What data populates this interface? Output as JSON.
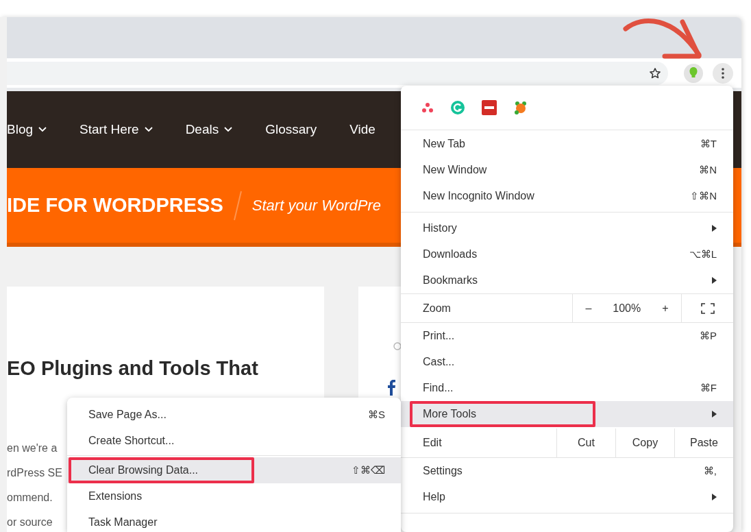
{
  "site": {
    "nav": [
      {
        "label": "Blog",
        "dropdown": true
      },
      {
        "label": "Start Here",
        "dropdown": true
      },
      {
        "label": "Deals",
        "dropdown": true
      },
      {
        "label": "Glossary",
        "dropdown": false
      },
      {
        "label": "Vide",
        "dropdown": false
      }
    ],
    "banner": {
      "title": "IDE FOR WORDPRESS",
      "tagline": "Start your WordPre"
    },
    "article": {
      "heading": "EO Plugins and Tools That",
      "lines": [
        "en we're a",
        "rdPress SE",
        "ommend.",
        "or source"
      ]
    }
  },
  "menu": {
    "items": [
      {
        "kind": "item",
        "label": "New Tab",
        "shortcut": "⌘T",
        "submenu": false,
        "selected": false,
        "annotated": false
      },
      {
        "kind": "item",
        "label": "New Window",
        "shortcut": "⌘N",
        "submenu": false,
        "selected": false,
        "annotated": false
      },
      {
        "kind": "item",
        "label": "New Incognito Window",
        "shortcut": "⇧⌘N",
        "submenu": false,
        "selected": false,
        "annotated": false
      },
      {
        "kind": "separator"
      },
      {
        "kind": "item",
        "label": "History",
        "submenu": true,
        "selected": false,
        "annotated": false
      },
      {
        "kind": "item",
        "label": "Downloads",
        "shortcut": "⌥⌘L",
        "submenu": false,
        "selected": false,
        "annotated": false
      },
      {
        "kind": "item",
        "label": "Bookmarks",
        "submenu": true,
        "selected": false,
        "annotated": false
      },
      {
        "kind": "zoom",
        "label": "Zoom",
        "minus": "–",
        "value": "100%",
        "plus": "+"
      },
      {
        "kind": "item",
        "label": "Print...",
        "shortcut": "⌘P",
        "submenu": false,
        "selected": false,
        "annotated": false
      },
      {
        "kind": "item",
        "label": "Cast...",
        "submenu": false,
        "selected": false,
        "annotated": false
      },
      {
        "kind": "item",
        "label": "Find...",
        "shortcut": "⌘F",
        "submenu": false,
        "selected": false,
        "annotated": false
      },
      {
        "kind": "item",
        "label": "More Tools",
        "submenu": true,
        "selected": true,
        "annotated": true
      },
      {
        "kind": "edit",
        "label": "Edit",
        "actions": [
          "Cut",
          "Copy",
          "Paste"
        ]
      },
      {
        "kind": "item",
        "label": "Settings",
        "shortcut": "⌘,",
        "submenu": false,
        "selected": false,
        "annotated": false
      },
      {
        "kind": "item",
        "label": "Help",
        "submenu": true,
        "selected": false,
        "annotated": false
      },
      {
        "kind": "separator"
      }
    ]
  },
  "submenu": {
    "items": [
      {
        "kind": "item",
        "label": "Save Page As...",
        "shortcut": "⌘S",
        "selected": false,
        "annotated": false
      },
      {
        "kind": "item",
        "label": "Create Shortcut...",
        "selected": false,
        "annotated": false
      },
      {
        "kind": "separator"
      },
      {
        "kind": "item",
        "label": "Clear Browsing Data...",
        "shortcut": "⇧⌘⌫",
        "selected": true,
        "annotated": true
      },
      {
        "kind": "item",
        "label": "Extensions",
        "selected": false,
        "annotated": false
      },
      {
        "kind": "item",
        "label": "Task Manager",
        "selected": false,
        "annotated": false
      }
    ]
  }
}
